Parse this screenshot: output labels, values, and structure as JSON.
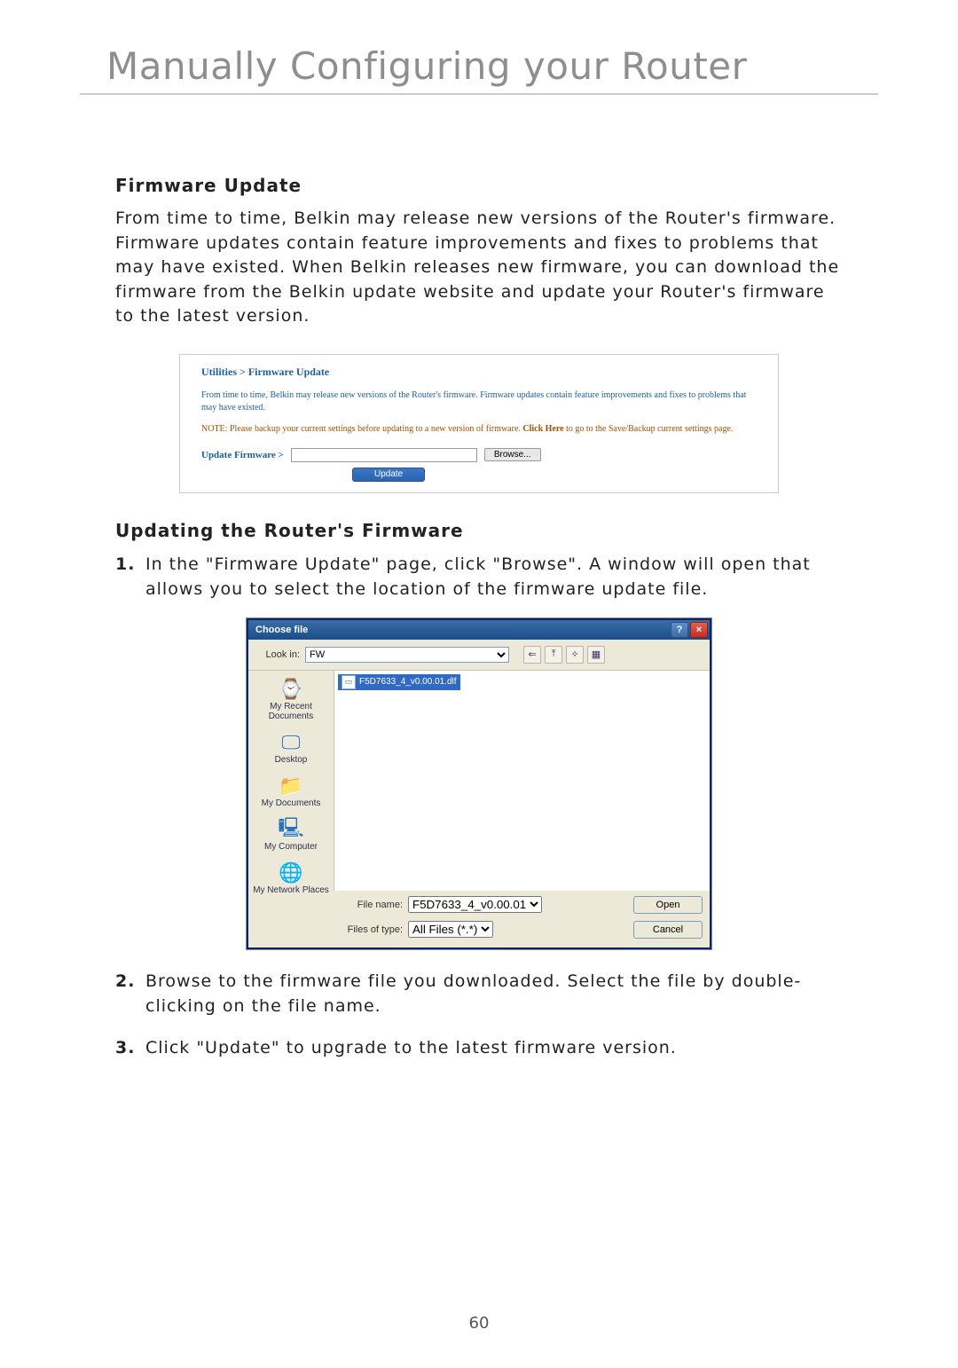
{
  "page": {
    "title": "Manually Configuring your Router",
    "number": "60"
  },
  "section1": {
    "heading": "Firmware Update",
    "paragraph": "From time to time, Belkin may release new versions of the Router's firmware. Firmware updates contain feature improvements and fixes to problems that may have existed. When Belkin releases new firmware, you can download the firmware from the Belkin update website and update your Router's firmware to the latest version."
  },
  "panel1": {
    "breadcrumb": "Utilities > Firmware Update",
    "para": "From time to time, Belkin may release new versions of the Router's firmware. Firmware updates contain feature improvements and fixes to problems that may have existed.",
    "note_prefix": "NOTE: Please backup your current settings before updating to a new version of firmware. ",
    "note_link": "Click Here",
    "note_suffix": " to go to the Save/Backup current settings page.",
    "label": "Update Firmware >",
    "browse": "Browse...",
    "update": "Update"
  },
  "section2": {
    "heading": "Updating the Router's Firmware"
  },
  "steps": {
    "s1_num": "1.",
    "s1_text": "In the \"Firmware Update\" page, click \"Browse\". A window will open that allows you to select the location of the firmware update file.",
    "s2_num": "2.",
    "s2_text": "Browse to the firmware file you downloaded. Select the file by double-clicking on the file name.",
    "s3_num": "3.",
    "s3_text": "Click \"Update\" to upgrade to the latest firmware version."
  },
  "dialog": {
    "title": "Choose file",
    "help": "?",
    "close": "×",
    "lookin_label": "Look in:",
    "lookin_value": "FW",
    "nav_back": "⇐",
    "nav_up": "⤒",
    "nav_new": "✧",
    "nav_view": "▦",
    "file_item": "F5D7633_4_v0.00.01.dlf",
    "places": [
      "My Recent Documents",
      "Desktop",
      "My Documents",
      "My Computer",
      "My Network Places"
    ],
    "place_icons": [
      "⌚",
      "🖵",
      "📁",
      "🖳",
      "🌐"
    ],
    "filename_label": "File name:",
    "filename_value": "F5D7633_4_v0.00.01",
    "filetype_label": "Files of type:",
    "filetype_value": "All Files (*.*)",
    "open": "Open",
    "cancel": "Cancel"
  }
}
